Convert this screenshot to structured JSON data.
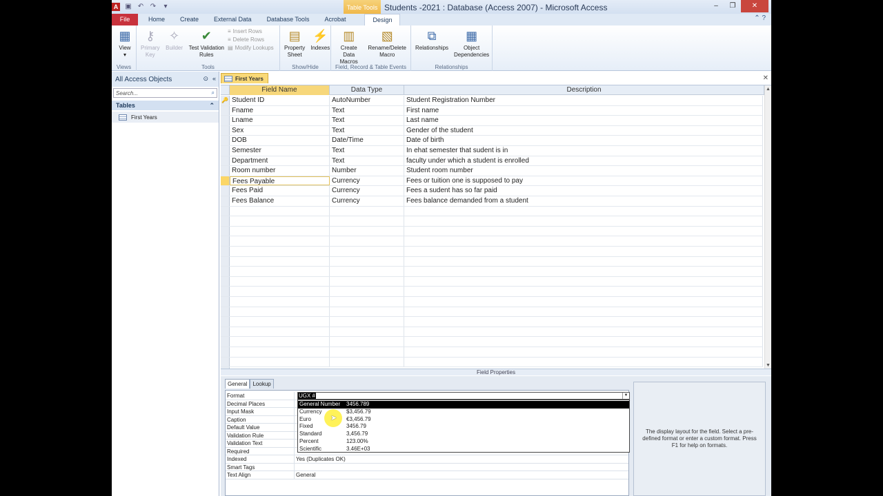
{
  "window": {
    "title": "Students -2021 : Database (Access 2007)  -  Microsoft Access",
    "context_tab": "Table Tools"
  },
  "ribbon_tabs": [
    "File",
    "Home",
    "Create",
    "External Data",
    "Database Tools",
    "Acrobat",
    "Design"
  ],
  "ribbon": {
    "views": {
      "label": "Views",
      "view": "View"
    },
    "tools": {
      "label": "Tools",
      "primary_key": "Primary\nKey",
      "builder": "Builder",
      "test_validation": "Test Validation\nRules",
      "insert_rows": "Insert Rows",
      "delete_rows": "Delete Rows",
      "modify_lookups": "Modify Lookups"
    },
    "showhide": {
      "label": "Show/Hide",
      "property_sheet": "Property\nSheet",
      "indexes": "Indexes"
    },
    "events": {
      "label": "Field, Record & Table Events",
      "create_data_macros": "Create Data\nMacros",
      "rename_delete_macro": "Rename/Delete\nMacro"
    },
    "relationships": {
      "label": "Relationships",
      "relationships_btn": "Relationships",
      "object_dependencies": "Object\nDependencies"
    }
  },
  "nav": {
    "header": "All Access Objects",
    "search_placeholder": "Search...",
    "group": "Tables",
    "items": [
      "First Years"
    ]
  },
  "document": {
    "tab": "First Years"
  },
  "grid": {
    "headers": {
      "field_name": "Field Name",
      "data_type": "Data Type",
      "description": "Description"
    },
    "rows": [
      {
        "field": "Student ID",
        "type": "AutoNumber",
        "desc": "Student Registration Number",
        "key": true
      },
      {
        "field": "Fname",
        "type": "Text",
        "desc": "First name"
      },
      {
        "field": "Lname",
        "type": "Text",
        "desc": "Last name"
      },
      {
        "field": "Sex",
        "type": "Text",
        "desc": "Gender of the student"
      },
      {
        "field": "DOB",
        "type": "Date/Time",
        "desc": "Date of birth"
      },
      {
        "field": "Semester",
        "type": "Text",
        "desc": "In ehat semester that sudent is in"
      },
      {
        "field": "Department",
        "type": "Text",
        "desc": "faculty under which a student is enrolled"
      },
      {
        "field": "Room number",
        "type": "Number",
        "desc": "Student room number"
      },
      {
        "field": "Fees Payable",
        "type": "Currency",
        "desc": "Fees or tuition one is supposed to pay",
        "current": true
      },
      {
        "field": "Fees Paid",
        "type": "Currency",
        "desc": "Fees a sudent has so far paid"
      },
      {
        "field": "Fees Balance",
        "type": "Currency",
        "desc": "Fees balance demanded from a student"
      }
    ]
  },
  "field_properties": {
    "title": "Field Properties",
    "tabs": [
      "General",
      "Lookup"
    ],
    "format_value": "UGX #",
    "rows": [
      {
        "label": "Format",
        "value": ""
      },
      {
        "label": "Decimal Places",
        "value": ""
      },
      {
        "label": "Input Mask",
        "value": ""
      },
      {
        "label": "Caption",
        "value": ""
      },
      {
        "label": "Default Value",
        "value": ""
      },
      {
        "label": "Validation Rule",
        "value": ""
      },
      {
        "label": "Validation Text",
        "value": ""
      },
      {
        "label": "Required",
        "value": ""
      },
      {
        "label": "Indexed",
        "value": "Yes (Duplicates OK)"
      },
      {
        "label": "Smart Tags",
        "value": ""
      },
      {
        "label": "Text Align",
        "value": "General"
      }
    ],
    "format_options": [
      {
        "name": "General Number",
        "example": "3456.789"
      },
      {
        "name": "Currency",
        "example": "$3,456.79"
      },
      {
        "name": "Euro",
        "example": "€3,456.79"
      },
      {
        "name": "Fixed",
        "example": "3456.79"
      },
      {
        "name": "Standard",
        "example": "3,456.79"
      },
      {
        "name": "Percent",
        "example": "123.00%"
      },
      {
        "name": "Scientific",
        "example": "3.46E+03"
      }
    ],
    "help_text": "The display layout for the field. Select a pre-defined format or enter a custom format. Press F1 for help on formats."
  }
}
